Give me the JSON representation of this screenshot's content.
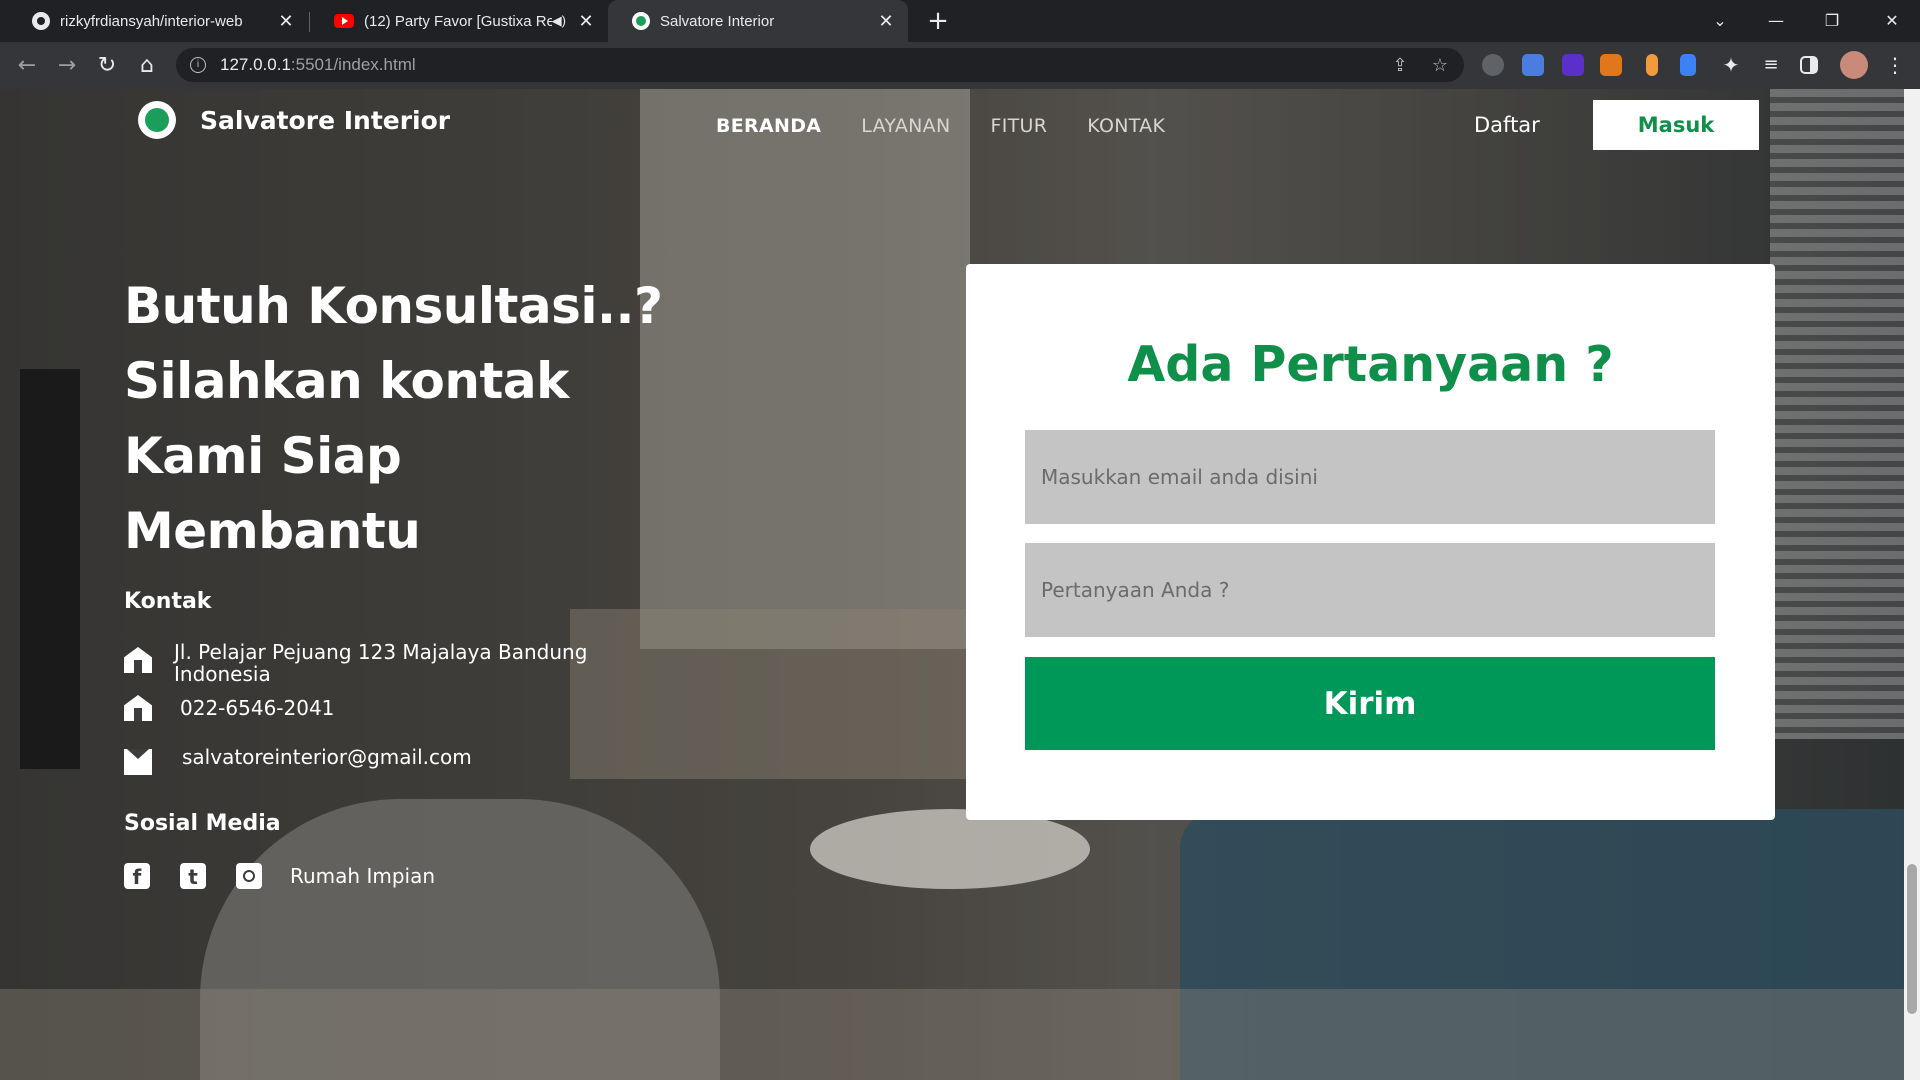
{
  "browser": {
    "tabs": [
      {
        "title": "rizkyfrdiansyah/interior-web",
        "icon": "github-icon"
      },
      {
        "title": "(12) Party Favor [Gustixa Rem",
        "icon": "youtube-icon",
        "audio": "speaker-icon"
      },
      {
        "title": "Salvatore Interior",
        "icon": "site-favicon"
      }
    ],
    "url_host": "127.0.0.1",
    "url_rest": ":5501/index.html"
  },
  "site": {
    "brand": "Salvatore Interior",
    "nav": [
      "BERANDA",
      "LAYANAN",
      "FITUR",
      "KONTAK"
    ],
    "active_nav": "BERANDA",
    "register_label": "Daftar",
    "login_label": "Masuk"
  },
  "hero": {
    "headline_lines": [
      "Butuh Konsultasi..?",
      "Silahkan kontak",
      "Kami Siap",
      "Membantu"
    ],
    "contact_title": "Kontak",
    "address_line1": "Jl. Pelajar Pejuang 123 Majalaya Bandung",
    "address_line2": "Indonesia",
    "phone": "022-6546-2041",
    "email": "salvatoreinterior@gmail.com",
    "social_title": "Sosial Media",
    "social_icons": [
      "facebook-icon",
      "twitter-icon",
      "instagram-icon"
    ],
    "social_handle": "Rumah Impian"
  },
  "form": {
    "title": "Ada Pertanyaan ?",
    "email_placeholder": "Masukkan email anda disini",
    "question_placeholder": "Pertanyaan Anda ?",
    "submit_label": "Kirim"
  },
  "colors": {
    "accent_green": "#009858",
    "title_green": "#0f8f4a",
    "field_gray": "#c4c4c4"
  }
}
